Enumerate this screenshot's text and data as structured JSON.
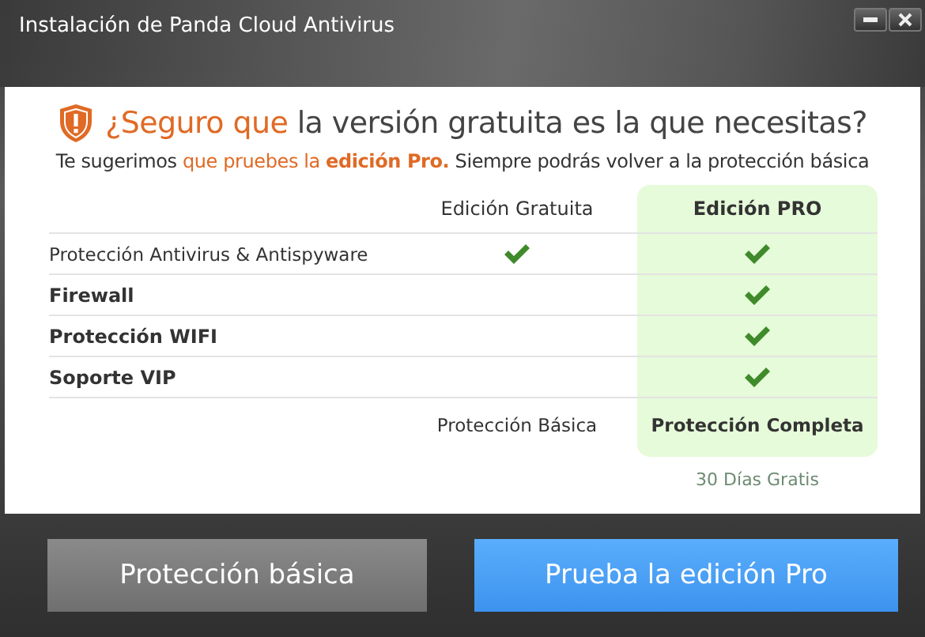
{
  "window": {
    "title": "Instalación de Panda Cloud Antivirus"
  },
  "heading": [
    {
      "kind": "accent",
      "text": "¿Seguro que"
    },
    {
      "kind": "plain",
      "text": " la versión gratuita es la que necesitas?"
    }
  ],
  "subtitle": [
    {
      "kind": "plain",
      "text": "Te sugerimos "
    },
    {
      "kind": "accent",
      "text": "que pruebes la "
    },
    {
      "kind": "strong",
      "text": "edición Pro."
    },
    {
      "kind": "plain",
      "text": " Siempre podrás volver a la protección básica"
    }
  ],
  "table": {
    "columns": [
      {
        "label": "Edición Gratuita",
        "highlighted": false
      },
      {
        "label": "Edición PRO",
        "highlighted": true
      }
    ],
    "rows": [
      {
        "feature": "Protección Antivirus & Antispyware",
        "bold": false,
        "free": true,
        "pro": true
      },
      {
        "feature": "Firewall",
        "bold": true,
        "free": false,
        "pro": true
      },
      {
        "feature": "Protección WIFI",
        "bold": true,
        "free": false,
        "pro": true
      },
      {
        "feature": "Soporte VIP",
        "bold": true,
        "free": false,
        "pro": true
      }
    ],
    "footer": [
      "Protección Básica",
      "Protección Completa"
    ],
    "note": "30 Días Gratis"
  },
  "buttons": [
    {
      "label": "Protección básica",
      "kind": "secondary"
    },
    {
      "label": "Prueba la edición Pro",
      "kind": "primary"
    }
  ]
}
